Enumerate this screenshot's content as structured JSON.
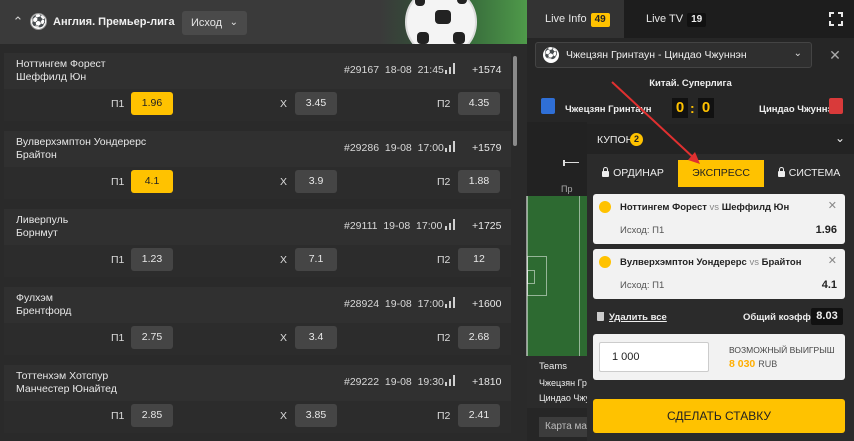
{
  "league": {
    "title": "Англия. Премьер-лига",
    "market_dropdown": "Исход"
  },
  "matches": [
    {
      "team1": "Ноттингем Форест",
      "team2": "Шеффилд Юн",
      "id": "#29167",
      "date": "18-08",
      "time": "21:45",
      "more": "+1574",
      "p1_label": "П1",
      "p1": "1.96",
      "x_label": "X",
      "x": "3.45",
      "p2_label": "П2",
      "p2": "4.35",
      "selected": "p1"
    },
    {
      "team1": "Вулверхэмптон Уондерерс",
      "team2": "Брайтон",
      "id": "#29286",
      "date": "19-08",
      "time": "17:00",
      "more": "+1579",
      "p1_label": "П1",
      "p1": "4.1",
      "x_label": "X",
      "x": "3.9",
      "p2_label": "П2",
      "p2": "1.88",
      "selected": "p1"
    },
    {
      "team1": "Ливерпуль",
      "team2": "Борнмут",
      "id": "#29111",
      "date": "19-08",
      "time": "17:00",
      "more": "+1725",
      "p1_label": "П1",
      "p1": "1.23",
      "x_label": "X",
      "x": "7.1",
      "p2_label": "П2",
      "p2": "12",
      "selected": ""
    },
    {
      "team1": "Фулхэм",
      "team2": "Брентфорд",
      "id": "#28924",
      "date": "19-08",
      "time": "17:00",
      "more": "+1600",
      "p1_label": "П1",
      "p1": "2.75",
      "x_label": "X",
      "x": "3.4",
      "p2_label": "П2",
      "p2": "2.68",
      "selected": ""
    },
    {
      "team1": "Тоттенхэм Хотспур",
      "team2": "Манчестер Юнайтед",
      "id": "#29222",
      "date": "19-08",
      "time": "19:30",
      "more": "+1810",
      "p1_label": "П1",
      "p1": "2.85",
      "x_label": "X",
      "x": "3.85",
      "p2_label": "П2",
      "p2": "2.41",
      "selected": ""
    }
  ],
  "right_tabs": {
    "live_info": "Live Info",
    "live_info_count": "49",
    "live_tv": "Live TV",
    "live_tv_count": "19"
  },
  "live_match": {
    "selector": "Чжецзян Гринтаун - Циндао Чжуннэн",
    "league": "Китай. Суперлига",
    "home": "Чжецзян Гринтаун",
    "away": "Циндао Чжуннэн",
    "home_score": "0",
    "away_score": "0",
    "home_color": "#2f6fd6",
    "away_color": "#d93a3a",
    "teams_header": "Teams",
    "row1": "Чжецзян Грин",
    "row2": "Циндао Чжун",
    "map_btn": "Карта ма",
    "pr": "Пр"
  },
  "coupon": {
    "title": "КУПОН",
    "count": "2",
    "tab_single": "ОРДИНАР",
    "tab_express": "ЭКСПРЕСС",
    "tab_system": "СИСТЕМА",
    "bets": [
      {
        "team1": "Ноттингем Форест",
        "vs": "vs",
        "team2": "Шеффилд Юн",
        "outcome": "Исход: П1",
        "odd": "1.96"
      },
      {
        "team1": "Вулверхэмптон Уондерерс",
        "vs": "vs",
        "team2": "Брайтон",
        "outcome": "Исход: П1",
        "odd": "4.1"
      }
    ],
    "delete_all": "Удалить все",
    "total_label": "Общий коэфф.:",
    "total_value": "8.03",
    "stake": "1 000",
    "win_label": "ВОЗМОЖНЫЙ ВЫИГРЫШ",
    "win_value": "8 030",
    "win_currency": "RUB",
    "make_bet": "СДЕЛАТЬ СТАВКУ"
  },
  "accent": "#ffc200"
}
